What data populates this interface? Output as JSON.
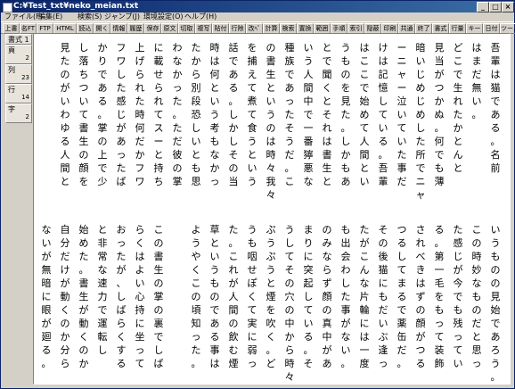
{
  "window": {
    "title": "C:¥Test_txt¥neko_meian.txt"
  },
  "menu": [
    "ファイル(F)",
    "編集(E)",
    "検索(S)",
    "ジャンプ(J)",
    "環境設定(O)",
    "ヘルプ(H)"
  ],
  "toolbar": [
    "上書",
    "名FT",
    "FTP",
    "HTML",
    "読込",
    "開く",
    "情報",
    "履歴",
    "保存",
    "原文",
    "切取",
    "複写",
    "貼付",
    "行除",
    "改ﾍﾟ",
    "計算",
    "検索",
    "置換",
    "範囲",
    "手順",
    "索引",
    "隠蔽",
    "印刷",
    "共通",
    "終了",
    "書式",
    "行量",
    "キー",
    "日付",
    "ツール"
  ],
  "side": [
    {
      "label": "書式 1",
      "value": ""
    },
    {
      "label": "頁",
      "value": "2"
    },
    {
      "label": "列",
      "value": "23"
    },
    {
      "label": "行",
      "value": "14"
    },
    {
      "label": "字",
      "value": "2"
    }
  ],
  "text": {
    "top": [
      "吾輩は猫である。名前",
      "はまだ無い。",
      "どこで生れたかとんと",
      "見当がつかぬ。何でも薄",
      "暗いじめじめした所でニャ",
      "ーニャー泣いていた事だ",
      "けは記憶している。吾輩",
      "はここで始めて人間とい",
      "うものを見た。しかもあ",
      "とで聞くとそれは書生と",
      "いう人間中で一番獰悪な",
      "種族であったそうだ。こ",
      "の書生というのは時々我々",
      "を捕えて煮て食うという",
      "話である。しかしその当",
      "時は何という考もなかっ",
      "たから別段恐しいとも思",
      "わなかった。ただ彼の掌",
      "に載せられてスーと持ち",
      "上げられた時何だかフワ",
      "フワした感じがあったば",
      "かりである。掌の上で少",
      "し落ちついて書生の顔を",
      "見たのがいわゆる人間と"
    ],
    "bottom": [
      "いうものの見始であろう。",
      "この時妙なものだと思っ",
      "た感じが今でも残ってい",
      "る。第一毛をもって装飾",
      "されべきはずの顔がつる",
      "つるしてまるで薬缶だ。",
      "その後猫にもだいぶ逢っ",
      "たがこんな片輪には一度",
      "も出会わした事がない。",
      "のみならず顔の真中があ",
      "まりに突起している。そ",
      "うしてその穴の中から時々",
      "ぷうぷうと煙を吹く。ど",
      "うも咽せぽくて実に弱っ",
      "た。これが人間の飲む煙",
      "草というものである事は",
      "ようやくこの頃知った。",
      "",
      "この書生の掌の裏でしば",
      "らくはよい心持に坐って",
      "おったが、しばらくする",
      "と非常な速力で運転し",
      "始めた。書生が動くのか",
      "自分だけが動くのか分ら",
      "ないが無暗に眼が廻る。"
    ]
  }
}
